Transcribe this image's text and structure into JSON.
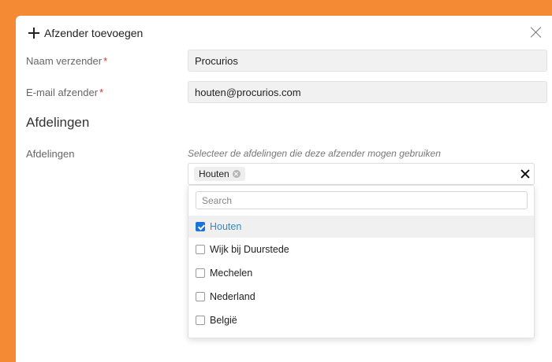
{
  "modal": {
    "title": "Afzender toevoegen",
    "icons": {
      "add": "plus-icon",
      "close": "close-icon"
    }
  },
  "form": {
    "sender_name": {
      "label": "Naam verzender",
      "required_mark": "*",
      "value": "Procurios"
    },
    "sender_email": {
      "label": "E-mail afzender",
      "required_mark": "*",
      "value": "houten@procurios.com"
    }
  },
  "departments": {
    "section_title": "Afdelingen",
    "label": "Afdelingen",
    "hint": "Selecteer de afdelingen die deze afzender mogen gebruiken",
    "selected_chips": [
      "Houten"
    ],
    "search_placeholder": "Search",
    "options": [
      {
        "label": "Houten",
        "checked": true
      },
      {
        "label": "Wijk bij Duurstede",
        "checked": false
      },
      {
        "label": "Mechelen",
        "checked": false
      },
      {
        "label": "Nederland",
        "checked": false
      },
      {
        "label": "België",
        "checked": false
      }
    ]
  },
  "colors": {
    "background": "#f58a34",
    "required": "#e03030",
    "checkbox_checked": "#1a73d9",
    "selected_text": "#3a87c8"
  }
}
